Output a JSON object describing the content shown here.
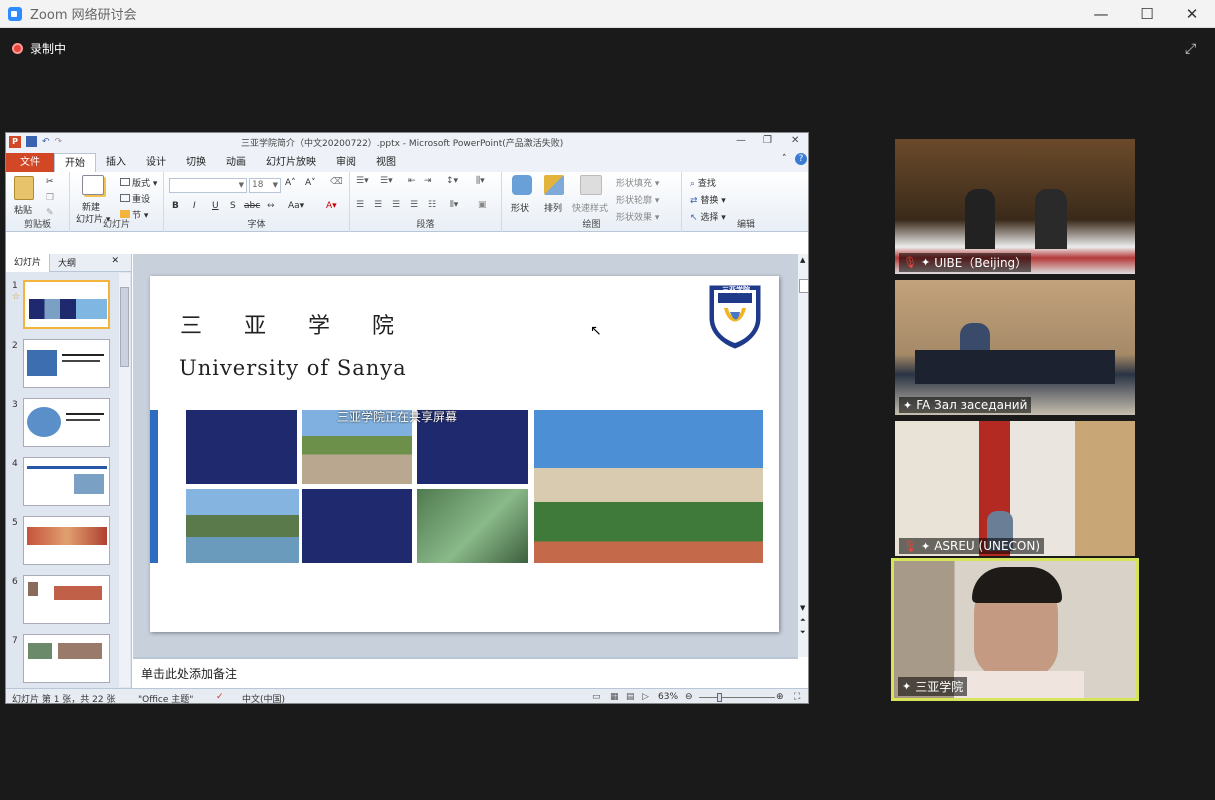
{
  "zoom": {
    "window_title": "Zoom 网络研讨会",
    "recording_label": "录制中",
    "minimize": "—",
    "maximize": "☐",
    "close": "✕",
    "fullscreen": "⤢"
  },
  "ppt": {
    "doc_title": "三亚学院简介（中文20200722）.pptx - Microsoft PowerPoint(产品激活失败)",
    "logo_letter": "P",
    "tabs": [
      "文件",
      "开始",
      "插入",
      "设计",
      "切换",
      "动画",
      "幻灯片放映",
      "审阅",
      "视图"
    ],
    "active_tab": "开始",
    "groups": {
      "clipboard": {
        "name": "剪贴板",
        "paste": "粘贴"
      },
      "slides": {
        "name": "幻灯片",
        "new_slide": "新建",
        "new_slide_2": "幻灯片 ▾",
        "layout": "版式 ▾",
        "reset": "重设",
        "section": "节 ▾"
      },
      "font": {
        "name": "字体",
        "size": "18",
        "bold": "B",
        "italic": "I",
        "underline": "U",
        "strike": "abc",
        "shadow": "S",
        "aa": "Aa▾",
        "grow": "A˄",
        "shrink": "A˅",
        "color": "A▾"
      },
      "paragraph": {
        "name": "段落"
      },
      "drawing": {
        "name": "绘图",
        "shape": "形状",
        "arrange": "排列",
        "quick_style": "快速样式",
        "fill": "形状填充 ▾",
        "outline": "形状轮廓 ▾",
        "effect": "形状效果 ▾"
      },
      "editing": {
        "name": "编辑",
        "find": "查找",
        "replace": "替换 ▾",
        "select": "选择 ▾"
      }
    },
    "pane_tabs": {
      "slides": "幻灯片",
      "outline": "大纲",
      "close": "✕"
    },
    "thumbnails": [
      "1",
      "2",
      "3",
      "4",
      "5",
      "6",
      "7"
    ],
    "slide": {
      "cn_title": "三亚学院",
      "en_title": "University of Sanya",
      "share_banner": "三亚学院正在共享屏幕",
      "logo_text": "三亚学院",
      "logo_ring": "UNIVERSITY OF SANYA"
    },
    "notes_placeholder": "单击此处添加备注",
    "status": {
      "slide_count": "幻灯片 第 1 张，共 22 张",
      "theme": "\"Office 主题\"",
      "language": "中文(中国)",
      "zoom": "63%"
    }
  },
  "participants": [
    {
      "name": "UIBE（Beijing）",
      "muted": true
    },
    {
      "name": "FA Зал заседаний",
      "muted": false
    },
    {
      "name": "ASREU (UNECON)",
      "muted": true
    },
    {
      "name": "三亚学院",
      "muted": false,
      "active": true
    }
  ],
  "colors": {
    "accent": "#2d8cff",
    "rec": "#e8453c",
    "active_border": "#d6e45a",
    "slide_navy": "#1f2a6e",
    "ppt_file": "#d24726"
  }
}
